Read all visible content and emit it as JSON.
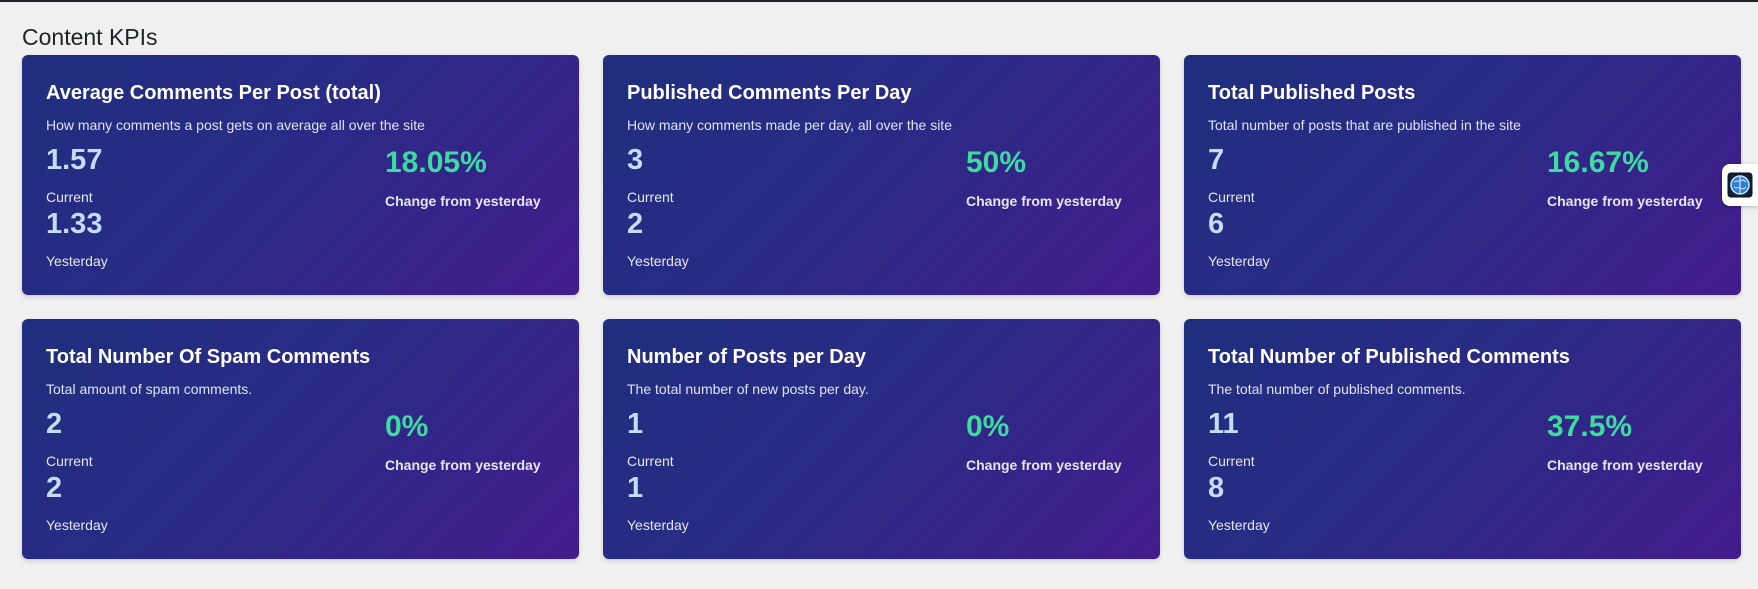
{
  "section": {
    "title": "Content KPIs"
  },
  "common": {
    "current_label": "Current",
    "yesterday_label": "Yesterday",
    "change_label": "Change from yesterday"
  },
  "cards": [
    {
      "title": "Average Comments Per Post (total)",
      "description": "How many comments a post gets on average all over the site",
      "current": "1.57",
      "yesterday": "1.33",
      "change": "18.05%"
    },
    {
      "title": "Published Comments Per Day",
      "description": "How many comments made per day, all over the site",
      "current": "3",
      "yesterday": "2",
      "change": "50%"
    },
    {
      "title": "Total Published Posts",
      "description": "Total number of posts that are published in the site",
      "current": "7",
      "yesterday": "6",
      "change": "16.67%"
    },
    {
      "title": "Total Number Of Spam Comments",
      "description": "Total amount of spam comments.",
      "current": "2",
      "yesterday": "2",
      "change": "0%"
    },
    {
      "title": "Number of Posts per Day",
      "description": "The total number of new posts per day.",
      "current": "1",
      "yesterday": "1",
      "change": "0%"
    },
    {
      "title": "Total Number of Published Comments",
      "description": "The total number of published comments.",
      "current": "11",
      "yesterday": "8",
      "change": "37.5%"
    }
  ],
  "side_widget": {
    "icon": "brain-icon"
  },
  "colors": {
    "card_gradient_start": "#1e2f7e",
    "card_gradient_end": "#431c8c",
    "value_color": "#c3dcf7",
    "change_color": "#3ddba0",
    "page_background": "#f0f0f1"
  }
}
